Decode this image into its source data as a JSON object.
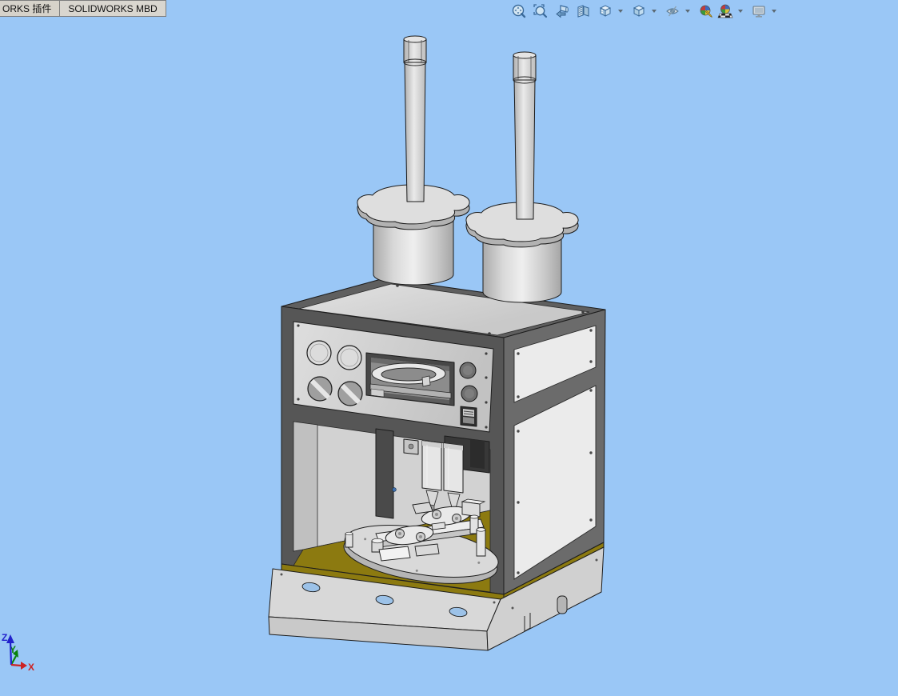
{
  "tab_bar": {
    "tabs": [
      {
        "label": "ORKS 插件"
      },
      {
        "label": "SOLIDWORKS MBD"
      }
    ]
  },
  "view_toolbar": {
    "buttons": [
      {
        "icon": "zoom-to-fit-icon",
        "has_dropdown": false
      },
      {
        "icon": "zoom-to-area-icon",
        "has_dropdown": false
      },
      {
        "icon": "previous-view-icon",
        "has_dropdown": false
      },
      {
        "icon": "section-view-icon",
        "has_dropdown": false
      },
      {
        "icon": "view-orientation-icon",
        "has_dropdown": true
      },
      {
        "icon": "display-style-icon",
        "has_dropdown": true
      },
      {
        "icon": "hide-show-items-icon",
        "has_dropdown": true
      },
      {
        "icon": "edit-appearance-icon",
        "has_dropdown": false
      },
      {
        "icon": "apply-scene-icon",
        "has_dropdown": true
      },
      {
        "icon": "view-settings-icon",
        "has_dropdown": true
      }
    ]
  },
  "triad": {
    "x_label": "X",
    "y_label": "Y",
    "z_label": "Z"
  },
  "palette": {
    "bg": "#9ac7f6",
    "outline": "#1c1c1c",
    "frame": "#565656",
    "frame_right": "#6b6b6b",
    "panel_light": "#ebebeb",
    "metal": "#d9d9d9",
    "olive": "#8c7a10",
    "hole_blue": "#9cc2e8",
    "triad_x": "#cc2222",
    "triad_y": "#0a820a",
    "triad_z": "#2222cc"
  }
}
